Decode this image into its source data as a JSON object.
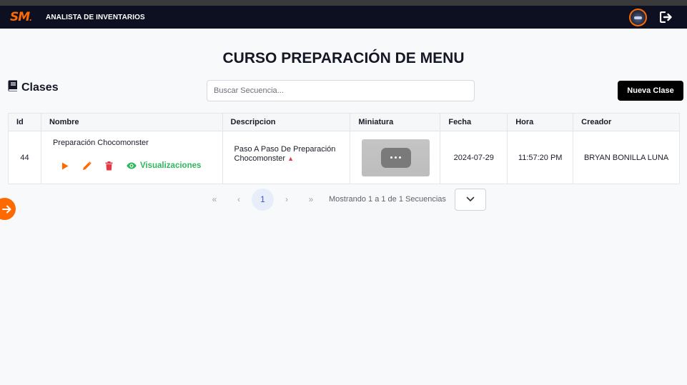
{
  "header": {
    "brand": "SM",
    "role_title": "ANALISTA DE INVENTARIOS",
    "icons": {
      "avatar": "user-avatar",
      "logout": "logout-icon"
    }
  },
  "page": {
    "title": "CURSO PREPARACIÓN DE MENU"
  },
  "section": {
    "title": "Clases",
    "icon": "book-icon"
  },
  "search": {
    "placeholder": "Buscar Secuencia..."
  },
  "actions": {
    "new_label": "Nueva Clase"
  },
  "table": {
    "columns": [
      "Id",
      "Nombre",
      "Descripcion",
      "Miniatura",
      "Fecha",
      "Hora",
      "Creador"
    ],
    "rows": [
      {
        "id": "44",
        "nombre": "Preparación Chocomonster",
        "views_label": "Visualizaciones",
        "descripcion": "Paso A Paso De Preparación Chocomonster",
        "fecha": "2024-07-29",
        "hora": "11:57:20 PM",
        "creador": "BRYAN BONILLA LUNA"
      }
    ]
  },
  "pagination": {
    "first": "«",
    "prev": "‹",
    "current": "1",
    "next": "›",
    "last": "»",
    "info": "Mostrando 1 a 1 de 1 Secuencias"
  },
  "colors": {
    "accent": "#ff6a00",
    "topbar": "#0d1021",
    "views": "#2eb85c",
    "delete": "#e53946",
    "active_page": "#3e56c6"
  }
}
